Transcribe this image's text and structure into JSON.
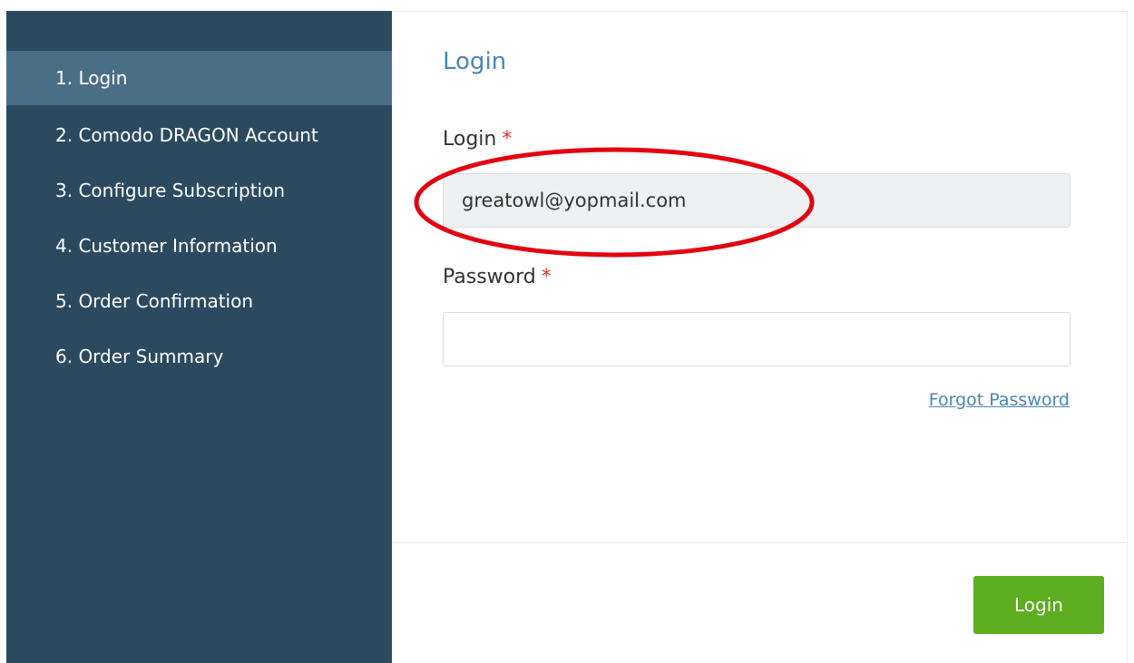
{
  "sidebar": {
    "steps": [
      {
        "label": "1. Login"
      },
      {
        "label": "2. Comodo DRAGON Account"
      },
      {
        "label": "3. Configure Subscription"
      },
      {
        "label": "4. Customer Information"
      },
      {
        "label": "5. Order Confirmation"
      },
      {
        "label": "6. Order Summary"
      }
    ],
    "active_step": "1. Login"
  },
  "form": {
    "title": "Login",
    "login_label": "Login",
    "login_value": "greatowl@yopmail.com",
    "password_label": "Password",
    "password_value": "",
    "required_marker": "*",
    "forgot_password": "Forgot Password",
    "submit_label": "Login"
  },
  "annotation": {
    "shape": "ellipse",
    "color": "#e3000f",
    "target": "login-field"
  },
  "colors": {
    "sidebar_bg": "#2c4a5f",
    "sidebar_active_bg": "#4b6e87",
    "title_blue": "#4a86b5",
    "submit_green": "#5cad1f",
    "required_red": "#e3342f"
  }
}
